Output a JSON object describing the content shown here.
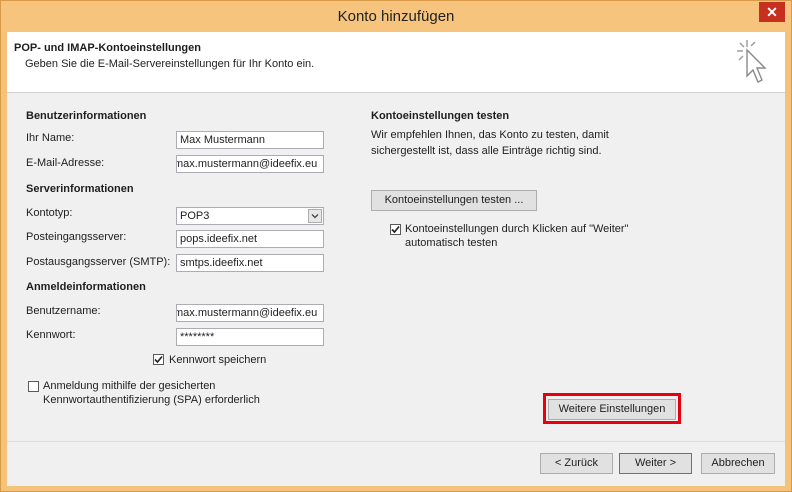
{
  "window": {
    "title": "Konto hinzufügen",
    "close_glyph": "✕"
  },
  "header": {
    "title": "POP- und IMAP-Kontoeinstellungen",
    "subtitle": "Geben Sie die E-Mail-Servereinstellungen für Ihr Konto ein.",
    "icon": "cursor-sparkle-icon"
  },
  "user_info": {
    "section": "Benutzerinformationen",
    "name_label": "Ihr Name:",
    "name_value": "Max Mustermann",
    "email_label": "E-Mail-Adresse:",
    "email_value": "max.mustermann@ideefix.eu"
  },
  "server_info": {
    "section": "Serverinformationen",
    "type_label": "Kontotyp:",
    "type_value": "POP3",
    "incoming_label": "Posteingangsserver:",
    "incoming_value": "pops.ideefix.net",
    "outgoing_label": "Postausgangsserver (SMTP):",
    "outgoing_value": "smtps.ideefix.net"
  },
  "logon_info": {
    "section": "Anmeldeinformationen",
    "username_label": "Benutzername:",
    "username_value": "max.mustermann@ideefix.eu",
    "password_label": "Kennwort:",
    "password_value": "********",
    "remember_label": "Kennwort speichern",
    "remember_checked": true,
    "spa_label_line1": "Anmeldung mithilfe der gesicherten",
    "spa_label_line2": "Kennwortauthentifizierung (SPA) erforderlich",
    "spa_checked": false
  },
  "test": {
    "section": "Kontoeinstellungen testen",
    "description_line1": "Wir empfehlen Ihnen, das Konto zu testen, damit",
    "description_line2": "sichergestellt ist, dass alle Einträge richtig sind.",
    "test_button": "Kontoeinstellungen testen ...",
    "auto_test_line1": "Kontoeinstellungen durch Klicken auf \"Weiter\"",
    "auto_test_line2": "automatisch testen",
    "auto_test_checked": true
  },
  "more_settings_button": "Weitere Einstellungen",
  "footer": {
    "back_button": "< Zurück",
    "next_button": "Weiter >",
    "cancel_button": "Abbrechen"
  },
  "colors": {
    "titlebar": "#f6c47d",
    "close": "#c7301f",
    "highlight": "#e8000f"
  }
}
